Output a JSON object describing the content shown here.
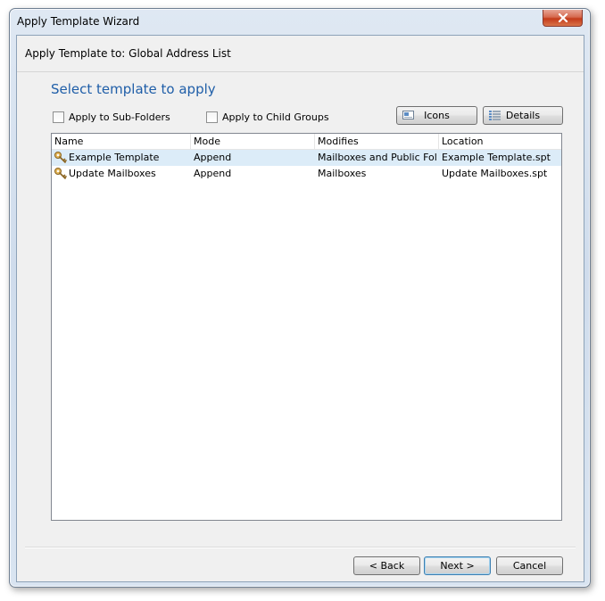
{
  "window": {
    "title": "Apply Template Wizard"
  },
  "header": {
    "text": "Apply Template to: Global Address List"
  },
  "page": {
    "heading": "Select template to apply"
  },
  "options": {
    "subfolders_label": "Apply to Sub-Folders",
    "childgroups_label": "Apply to Child Groups"
  },
  "view_buttons": {
    "icons_label": "Icons",
    "details_label": "Details"
  },
  "table": {
    "columns": [
      "Name",
      "Mode",
      "Modifies",
      "Location"
    ],
    "rows": [
      {
        "name": "Example Template",
        "mode": "Append",
        "modifies": "Mailboxes and Public Fold...",
        "location": "Example Template.spt",
        "icon": "template-key-icon"
      },
      {
        "name": "Update Mailboxes",
        "mode": "Append",
        "modifies": "Mailboxes",
        "location": "Update Mailboxes.spt",
        "icon": "template-key-icon"
      }
    ],
    "selected_row": 0
  },
  "footer": {
    "back_label": "< Back",
    "next_label": "Next >",
    "cancel_label": "Cancel"
  },
  "colors": {
    "heading": "#1f5ea8",
    "selection": "#dcecf8",
    "close": "#c43b1a"
  }
}
